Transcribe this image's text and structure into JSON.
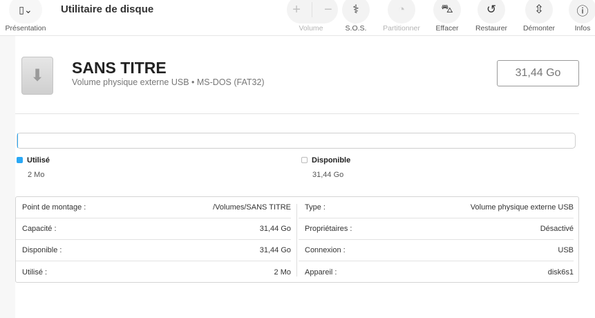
{
  "toolbar": {
    "title": "Utilitaire de disque",
    "presentation": "Présentation",
    "buttons": [
      {
        "label": "Volume"
      },
      {
        "label": "S.O.S."
      },
      {
        "label": "Partitionner"
      },
      {
        "label": "Effacer"
      },
      {
        "label": "Restaurer"
      },
      {
        "label": "Démonter"
      },
      {
        "label": "Infos"
      }
    ]
  },
  "volume": {
    "name": "SANS TITRE",
    "subtitle": "Volume physique externe USB • MS-DOS (FAT32)",
    "size": "31,44 Go"
  },
  "usage": {
    "used_label": "Utilisé",
    "used_value": "2 Mo",
    "used_color": "#2aa8f5",
    "free_label": "Disponible",
    "free_value": "31,44 Go",
    "used_fraction": 0.0001
  },
  "info": {
    "left": [
      {
        "k": "Point de montage :",
        "v": "/Volumes/SANS TITRE"
      },
      {
        "k": "Capacité :",
        "v": "31,44 Go"
      },
      {
        "k": "Disponible :",
        "v": "31,44 Go"
      },
      {
        "k": "Utilisé :",
        "v": "2 Mo"
      }
    ],
    "right": [
      {
        "k": "Type :",
        "v": "Volume physique externe USB"
      },
      {
        "k": "Propriétaires :",
        "v": "Désactivé"
      },
      {
        "k": "Connexion :",
        "v": "USB"
      },
      {
        "k": "Appareil :",
        "v": "disk6s1"
      }
    ]
  }
}
